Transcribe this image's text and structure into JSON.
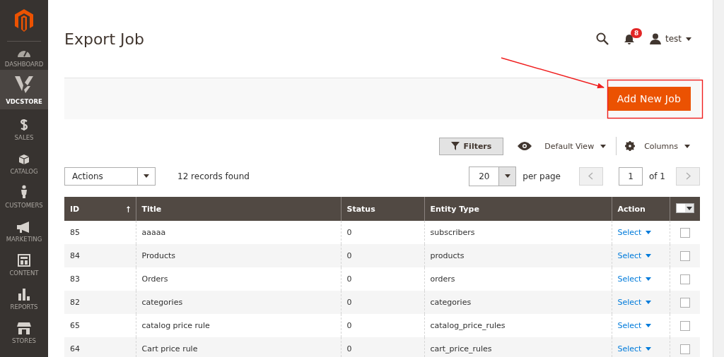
{
  "sidebar": {
    "items": [
      {
        "label": "DASHBOARD",
        "kind": "dashboard",
        "selected": false
      },
      {
        "label": "VDCSTORE",
        "kind": "vdc",
        "selected": true
      },
      {
        "label": "SALES",
        "kind": "sales",
        "selected": false
      },
      {
        "label": "CATALOG",
        "kind": "catalog",
        "selected": false
      },
      {
        "label": "CUSTOMERS",
        "kind": "customers",
        "selected": false
      },
      {
        "label": "MARKETING",
        "kind": "marketing",
        "selected": false
      },
      {
        "label": "CONTENT",
        "kind": "content",
        "selected": false
      },
      {
        "label": "REPORTS",
        "kind": "reports",
        "selected": false
      },
      {
        "label": "STORES",
        "kind": "stores",
        "selected": false
      }
    ]
  },
  "header": {
    "title": "Export Job",
    "notification_count": "8",
    "user": "test"
  },
  "action_bar": {
    "button": "Add New Job"
  },
  "toolbar": {
    "filters": "Filters",
    "view": "Default View",
    "columns": "Columns"
  },
  "grid_controls": {
    "mass_actions": "Actions",
    "records": "12 records found",
    "per_page": "20",
    "per_page_label": "per page",
    "page": "1",
    "page_total": "of 1"
  },
  "table": {
    "mass_select": {
      "checked": false
    },
    "columns": [
      {
        "label": "ID",
        "sorted": true
      },
      {
        "label": "Title",
        "sorted": false
      },
      {
        "label": "Status",
        "sorted": false
      },
      {
        "label": "Entity Type",
        "sorted": false
      },
      {
        "label": "Action",
        "sorted": false
      }
    ],
    "rows": [
      {
        "cells": [
          "85",
          "aaaaa",
          "0",
          "subscribers"
        ],
        "action": "Select",
        "checked": false
      },
      {
        "cells": [
          "84",
          "Products",
          "0",
          "products"
        ],
        "action": "Select",
        "checked": false
      },
      {
        "cells": [
          "83",
          "Orders",
          "0",
          "orders"
        ],
        "action": "Select",
        "checked": false
      },
      {
        "cells": [
          "82",
          "categories",
          "0",
          "categories"
        ],
        "action": "Select",
        "checked": false
      },
      {
        "cells": [
          "65",
          "catalog price rule",
          "0",
          "catalog_price_rules"
        ],
        "action": "Select",
        "checked": false
      },
      {
        "cells": [
          "64",
          "Cart price rule",
          "0",
          "cart_price_rules"
        ],
        "action": "Select",
        "checked": false
      }
    ]
  }
}
